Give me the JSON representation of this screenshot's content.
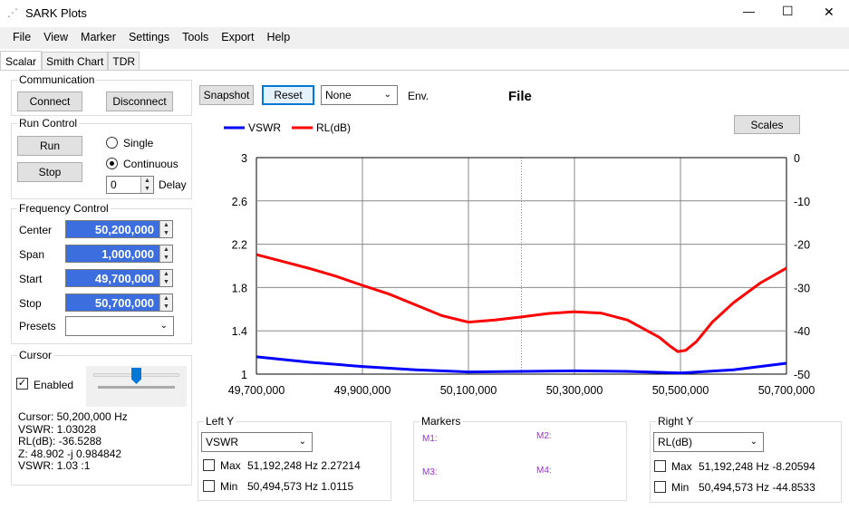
{
  "window": {
    "title": "SARK Plots",
    "minimize": "—",
    "maximize": "☐",
    "close": "✕"
  },
  "menu": [
    "File",
    "View",
    "Marker",
    "Settings",
    "Tools",
    "Export",
    "Help"
  ],
  "tabs": [
    "Scalar",
    "Smith Chart",
    "TDR"
  ],
  "communication": {
    "title": "Communication",
    "connect": "Connect",
    "disconnect": "Disconnect"
  },
  "run_control": {
    "title": "Run Control",
    "run": "Run",
    "stop": "Stop",
    "single": "Single",
    "continuous": "Continuous",
    "selected": "Continuous",
    "delay_value": "0",
    "delay_label": "Delay"
  },
  "frequency": {
    "title": "Frequency Control",
    "center_label": "Center",
    "center": "50,200,000",
    "span_label": "Span",
    "span": "1,000,000",
    "start_label": "Start",
    "start": "49,700,000",
    "stop_label": "Stop",
    "stop": "50,700,000",
    "presets_label": "Presets",
    "presets": ""
  },
  "cursor": {
    "title": "Cursor",
    "enabled_label": "Enabled",
    "enabled": true,
    "slider_position": 0.5,
    "lines": [
      "Cursor: 50,200,000 Hz",
      "VSWR: 1.03028",
      "RL(dB): -36.5288",
      "Z: 48.902 -j 0.984842",
      "VSWR: 1.03 :1"
    ]
  },
  "toolbar": {
    "snapshot": "Snapshot",
    "reset": "Reset",
    "source": "None",
    "env": "Env.",
    "title": "File",
    "scales": "Scales"
  },
  "left_y": {
    "title": "Left Y",
    "value": "VSWR",
    "max_label": "Max",
    "max": "51,192,248 Hz 2.27214",
    "min_label": "Min",
    "min": "50,494,573 Hz 1.0115"
  },
  "markers": {
    "title": "Markers",
    "m1": "M1:",
    "m2": "M2:",
    "m3": "M3:",
    "m4": "M4:"
  },
  "right_y": {
    "title": "Right Y",
    "value": "RL(dB)",
    "max_label": "Max",
    "max": "51,192,248 Hz -8.20594",
    "min_label": "Min",
    "min": "50,494,573 Hz -44.8533"
  },
  "colors": {
    "vswr": "#0000ff",
    "rl": "#ff0000",
    "field": "#3c6ee0"
  },
  "chart_data": {
    "type": "line",
    "x_ticks": [
      "49,700,000",
      "49,900,000",
      "50,100,000",
      "50,300,000",
      "50,500,000",
      "50,700,000"
    ],
    "xlim": [
      49700000,
      50700000
    ],
    "left_ticks": [
      "3",
      "2.6",
      "2.2",
      "1.8",
      "1.4",
      "1"
    ],
    "left_ylim": [
      1,
      3
    ],
    "right_ticks": [
      "0",
      "-10",
      "-20",
      "-30",
      "-40",
      "-50"
    ],
    "right_ylim": [
      -50,
      0
    ],
    "legend": [
      "VSWR",
      "RL(dB)"
    ],
    "series": [
      {
        "name": "VSWR",
        "axis": "left",
        "x": [
          49700000,
          49800000,
          49900000,
          50000000,
          50100000,
          50200000,
          50300000,
          50400000,
          50500000,
          50600000,
          50700000
        ],
        "y": [
          1.16,
          1.11,
          1.07,
          1.04,
          1.02,
          1.025,
          1.03,
          1.025,
          1.01,
          1.04,
          1.1
        ]
      },
      {
        "name": "RL(dB)",
        "axis": "right",
        "x": [
          49700000,
          49750000,
          49800000,
          49850000,
          49900000,
          49950000,
          50000000,
          50050000,
          50100000,
          50150000,
          50200000,
          50250000,
          50300000,
          50350000,
          50400000,
          50430000,
          50460000,
          50480000,
          50495000,
          50510000,
          50530000,
          50560000,
          50600000,
          50650000,
          50700000
        ],
        "y": [
          -22.4,
          -24,
          -25.6,
          -27.4,
          -29.5,
          -31.5,
          -34,
          -36.5,
          -38,
          -37.5,
          -36.8,
          -36,
          -35.6,
          -35.9,
          -37.5,
          -39.5,
          -41.5,
          -43.5,
          -44.8,
          -44.5,
          -42.5,
          -38,
          -33.5,
          -29,
          -25.5
        ]
      }
    ]
  }
}
